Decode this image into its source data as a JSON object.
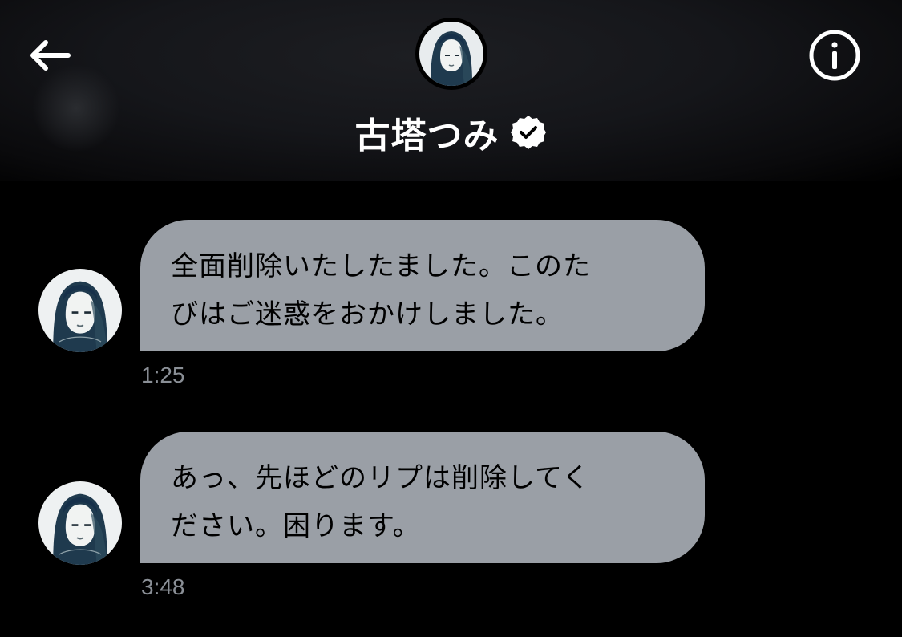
{
  "header": {
    "back_icon": "arrow-left-icon",
    "info_icon": "info-circle-icon",
    "profile_name": "古塔つみ",
    "verified_icon": "verified-badge-icon"
  },
  "messages": [
    {
      "text_line1": "全面削除いたしたました。このた",
      "text_line2": "びはご迷惑をおかけしました。",
      "time": "1:25"
    },
    {
      "text_line1": "あっ、先ほどのリプは削除してく",
      "text_line2": "ださい。困ります。",
      "time": "3:48"
    }
  ],
  "colors": {
    "background": "#000000",
    "bubble": "#9a9fa6",
    "timestamp": "#8a8f96",
    "text_on_dark": "#ffffff"
  }
}
